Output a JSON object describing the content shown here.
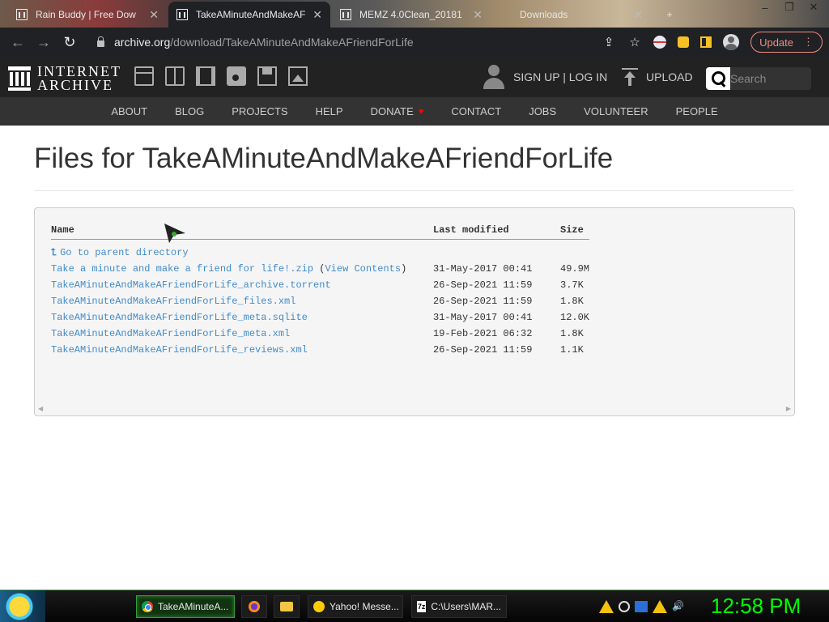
{
  "browser": {
    "tabs": [
      {
        "label": "Rain Buddy | Free Dow",
        "active": false
      },
      {
        "label": "TakeAMinuteAndMakeAFr",
        "active": true
      },
      {
        "label": "MEMZ 4.0Clean_20181",
        "active": false
      },
      {
        "label": "Downloads",
        "active": false
      }
    ],
    "url_host": "archive.org",
    "url_path": "/download/TakeAMinuteAndMakeAFriendForLife",
    "update_label": "Update"
  },
  "ia_header": {
    "logo_line1": "INTERNET",
    "logo_line2": "ARCHIVE",
    "media_icons": [
      "web-icon",
      "texts-icon",
      "video-icon",
      "audio-icon",
      "software-icon",
      "images-icon"
    ],
    "sign_in": "SIGN UP | LOG IN",
    "upload": "UPLOAD",
    "search_placeholder": "Search"
  },
  "nav": {
    "items": [
      "ABOUT",
      "BLOG",
      "PROJECTS",
      "HELP",
      "DONATE",
      "CONTACT",
      "JOBS",
      "VOLUNTEER",
      "PEOPLE"
    ]
  },
  "page": {
    "title": "Files for TakeAMinuteAndMakeAFriendForLife"
  },
  "listing": {
    "headers": {
      "name": "Name",
      "modified": "Last modified",
      "size": "Size"
    },
    "parent_link": "Go to parent directory",
    "files": [
      {
        "name": "Take a minute and make a friend for life!.zip",
        "extra": "View Contents",
        "modified": "31-May-2017 00:41",
        "size": "49.9M"
      },
      {
        "name": "TakeAMinuteAndMakeAFriendForLife_archive.torrent",
        "extra": "",
        "modified": "26-Sep-2021 11:59",
        "size": "3.7K"
      },
      {
        "name": "TakeAMinuteAndMakeAFriendForLife_files.xml",
        "extra": "",
        "modified": "26-Sep-2021 11:59",
        "size": "1.8K"
      },
      {
        "name": "TakeAMinuteAndMakeAFriendForLife_meta.sqlite",
        "extra": "",
        "modified": "31-May-2017 00:41",
        "size": "12.0K"
      },
      {
        "name": "TakeAMinuteAndMakeAFriendForLife_meta.xml",
        "extra": "",
        "modified": "19-Feb-2021 06:32",
        "size": "1.8K"
      },
      {
        "name": "TakeAMinuteAndMakeAFriendForLife_reviews.xml",
        "extra": "",
        "modified": "26-Sep-2021 11:59",
        "size": "1.1K"
      }
    ]
  },
  "taskbar": {
    "buttons": [
      {
        "label": "TakeAMinuteA...",
        "active": true
      },
      {
        "label": "",
        "active": false
      },
      {
        "label": "",
        "active": false
      },
      {
        "label": "Yahoo! Messe...",
        "active": false
      },
      {
        "label": "C:\\Users\\MAR...",
        "active": false
      }
    ],
    "clock": "12:58 PM"
  },
  "colors": {
    "link": "#428bca",
    "ia_dark": "#222222",
    "ia_nav": "#333333",
    "clock": "#00ff00",
    "update": "#f28b82",
    "donate_heart": "#ff0000"
  }
}
